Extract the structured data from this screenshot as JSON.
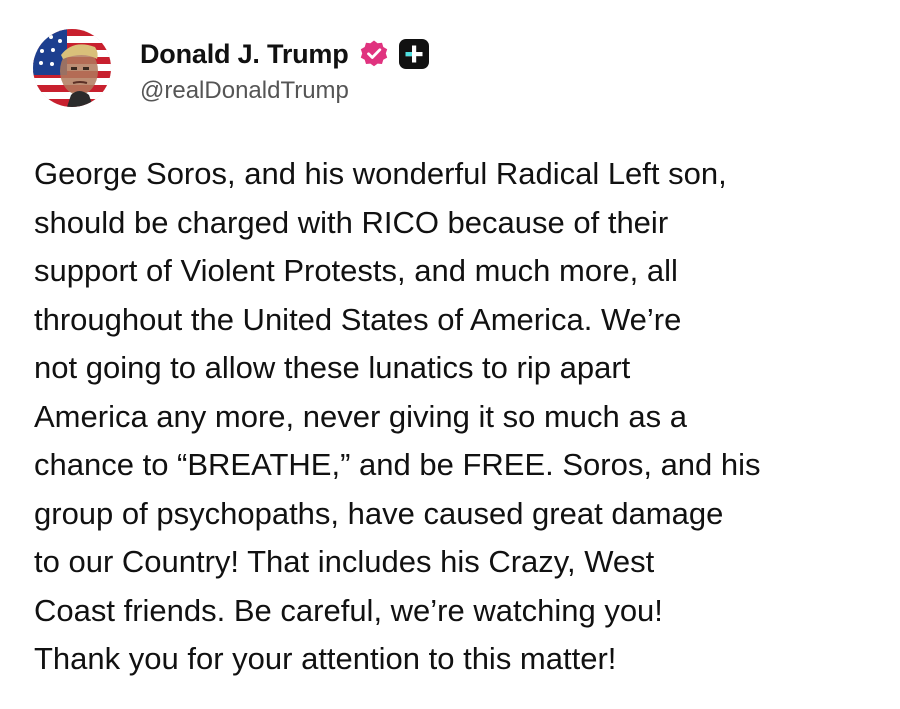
{
  "author": {
    "display_name": "Donald J. Trump",
    "handle": "@realDonaldTrump",
    "avatar_icon": "profile-photo-flag-portrait",
    "verified_icon": "verified-badge-icon",
    "subscriber_icon": "plus-badge-icon"
  },
  "colors": {
    "verified_badge": "#e0337f",
    "plus_badge_bg": "#111111",
    "plus_badge_accent": "#4fe0e0",
    "text": "#111111",
    "handle": "#555555"
  },
  "post": {
    "lines": [
      "George Soros, and his wonderful Radical Left son,",
      "should be charged with RICO because of their",
      "support of Violent Protests, and much more, all",
      "throughout the United States of America. We’re",
      "not going to allow these lunatics to rip apart",
      "America any more, never giving it so much as a",
      "chance to “BREATHE,” and be FREE. Soros, and his",
      "group of psychopaths, have caused great damage",
      "to our Country! That includes his Crazy, West",
      "Coast friends. Be careful, we’re watching you!",
      "Thank you for your attention to this matter!"
    ]
  }
}
